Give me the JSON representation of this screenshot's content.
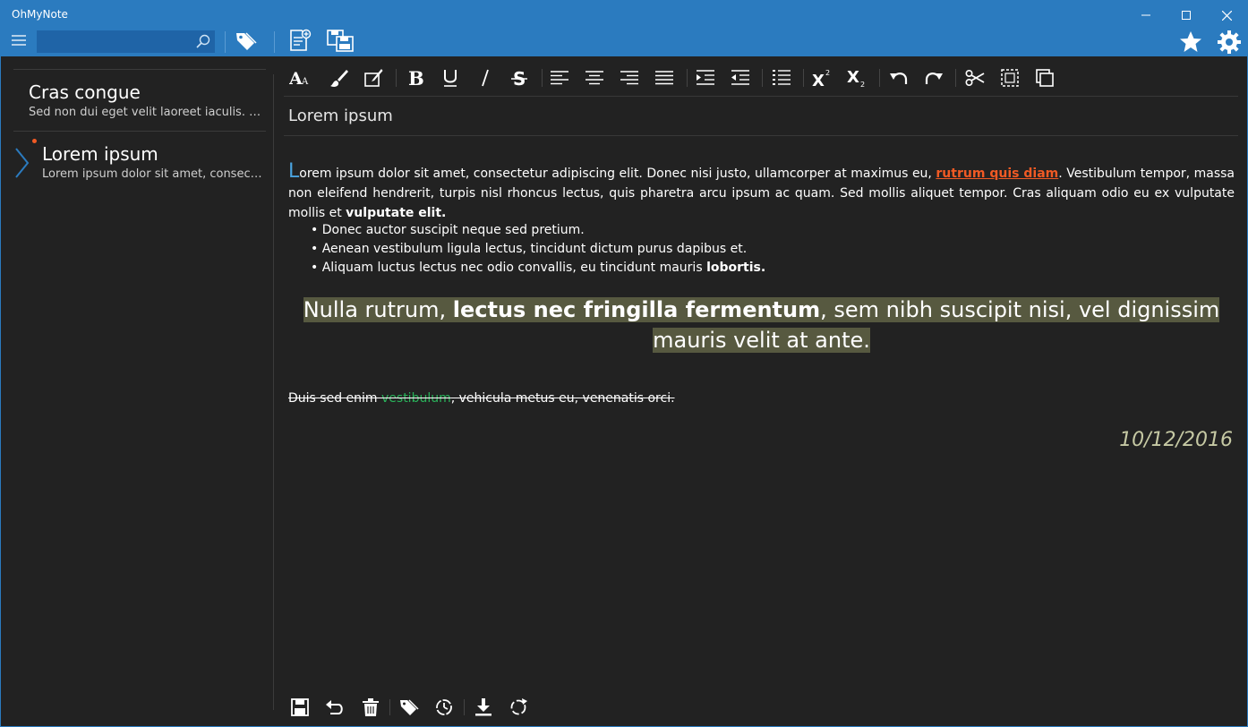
{
  "app": {
    "title": "OhMyNote"
  },
  "search": {
    "placeholder": "",
    "value": ""
  },
  "notes": [
    {
      "title": "Cras congue",
      "preview": "Sed non dui eget velit laoreet iaculis. Cras"
    },
    {
      "title": "Lorem ipsum",
      "preview": "Lorem ipsum dolor sit amet, consectetur",
      "selected": true,
      "unsaved_indicator_color": "#f15a24"
    }
  ],
  "editor": {
    "note_title": "Lorem ipsum",
    "body": {
      "dropcap": "L",
      "p1_a": "orem ipsum dolor sit amet, consectetur adipiscing elit. Donec nisi justo, ullamcorper at maximus eu, ",
      "p1_link": "rutrum quis diam",
      "p1_b": ". Vestibulum tempor, massa non eleifend hendrerit, turpis nisl rhoncus lectus, quis pharetra arcu ipsum ac quam. Sed mollis aliquet tempor. Cras aliquam odio eu ex vulputate mollis et ",
      "p1_bold": "vulputate elit",
      "p1_end": ".",
      "bullets": [
        {
          "text": "Donec auctor suscipit neque sed pretium.",
          "bold": ""
        },
        {
          "text": "Aenean vestibulum ligula lectus, tincidunt dictum purus dapibus et.",
          "bold": ""
        },
        {
          "text": "Aliquam luctus lectus nec odio convallis, eu tincidunt mauris ",
          "bold": "lobortis."
        }
      ],
      "highlight_a": "Nulla rutrum, ",
      "highlight_bold": "lectus nec fringilla fermentum",
      "highlight_b": ", sem nibh suscipit nisi, vel dignissim mauris velit at ante.",
      "strike_a": "Duis sed enim ",
      "strike_green": "vestibulum",
      "strike_b": ", vehicula metus eu, venenatis orci.",
      "date": "10/12/2016"
    }
  },
  "colors": {
    "accent": "#2b7bbf",
    "link_red": "#f15a24",
    "green_text": "#29b35a",
    "highlight_bg": "#575940",
    "date_text": "#c6c9a4"
  },
  "icons": {
    "toolbar": [
      "font-size-icon",
      "brush-icon",
      "highlight-icon",
      "bold-icon",
      "underline-icon",
      "italic-icon",
      "strikethrough-icon",
      "align-left-icon",
      "align-center-icon",
      "align-right-icon",
      "justify-icon",
      "indent-icon",
      "outdent-icon",
      "bullet-list-icon",
      "superscript-icon",
      "subscript-icon",
      "undo-icon",
      "redo-icon",
      "cut-icon",
      "select-all-icon",
      "copy-icon"
    ],
    "bottom": [
      "save-icon",
      "revert-icon",
      "delete-icon",
      "tags-icon",
      "history-icon",
      "download-icon",
      "sync-icon"
    ]
  }
}
